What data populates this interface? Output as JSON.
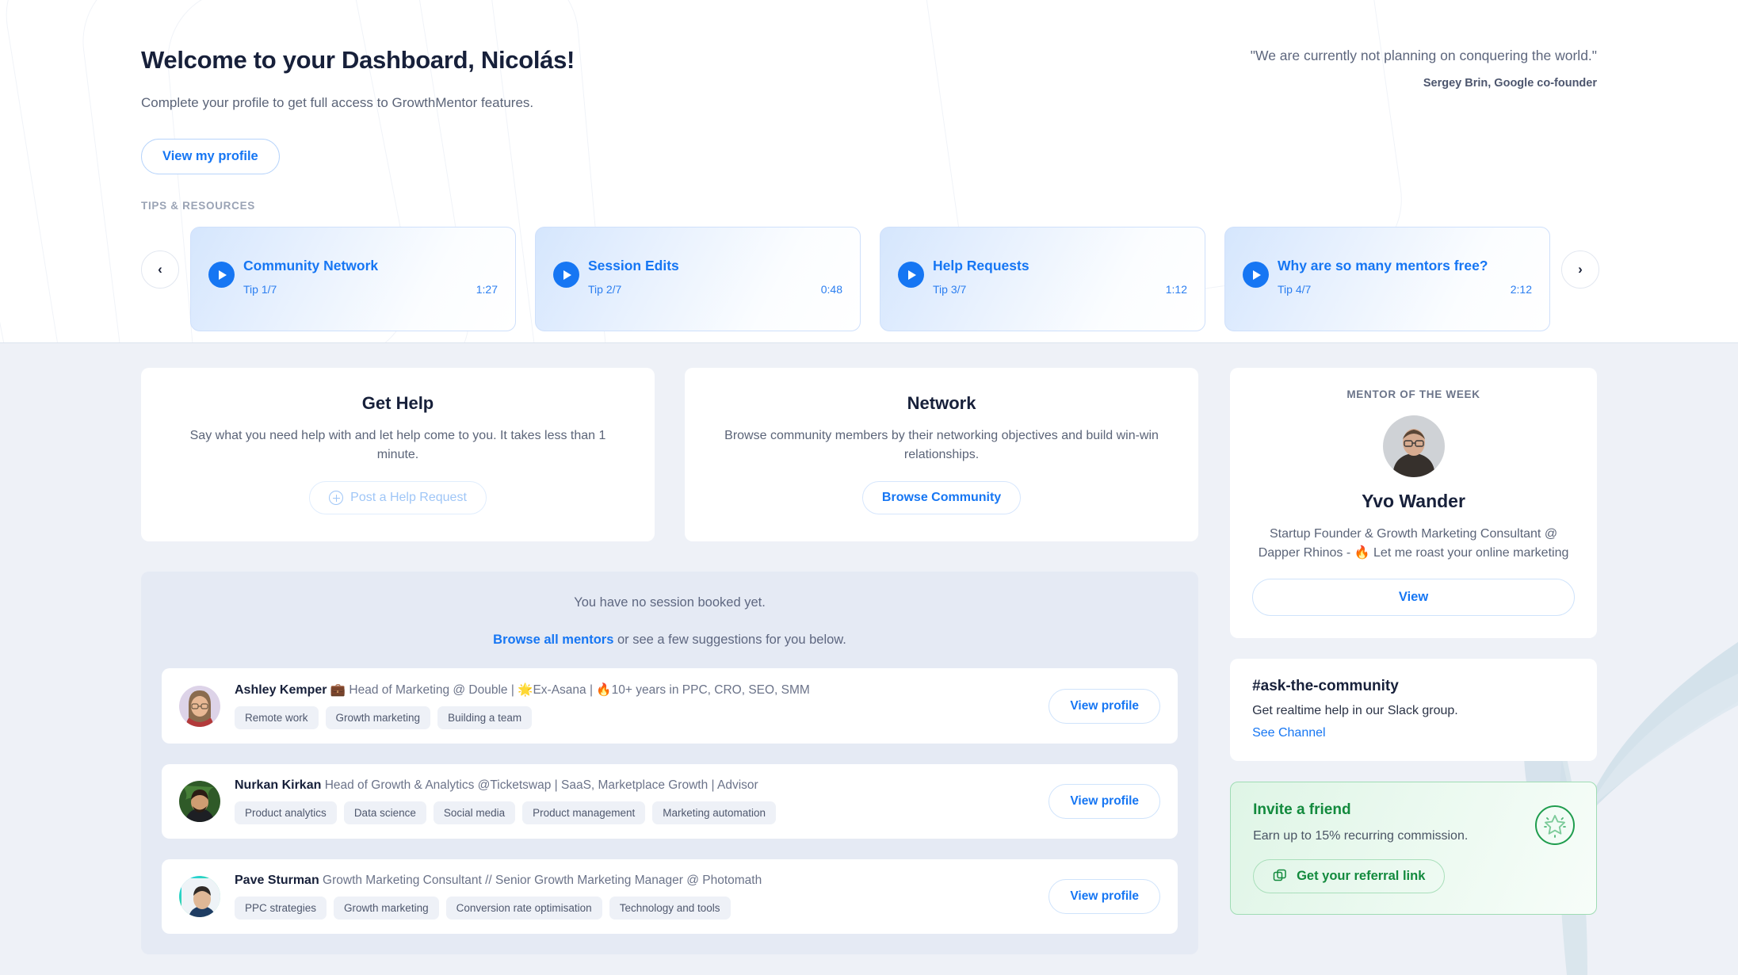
{
  "hero": {
    "title": "Welcome to your Dashboard, Nicolás!",
    "subtitle": "Complete your profile to get full access to GrowthMentor features.",
    "profile_button": "View my profile",
    "quote_text": "\"We are currently not planning on conquering the world.\"",
    "quote_author": "Sergey Brin, Google co-founder",
    "tips_label": "TIPS & RESOURCES",
    "prev_arrow": "‹",
    "next_arrow": "›"
  },
  "tips": [
    {
      "title": "Community Network",
      "index": "Tip 1/7",
      "duration": "1:27"
    },
    {
      "title": "Session Edits",
      "index": "Tip 2/7",
      "duration": "0:48"
    },
    {
      "title": "Help Requests",
      "index": "Tip 3/7",
      "duration": "1:12"
    },
    {
      "title": "Why are so many mentors free?",
      "index": "Tip 4/7",
      "duration": "2:12"
    }
  ],
  "get_help": {
    "title": "Get Help",
    "description": "Say what you need help with and let help come to you. It takes less than 1 minute.",
    "button": "Post a Help Request"
  },
  "network": {
    "title": "Network",
    "description": "Browse community members by their networking objectives and build win-win relationships.",
    "button": "Browse Community"
  },
  "sessions": {
    "empty_text": "You have no session booked yet.",
    "browse_link": "Browse all mentors",
    "browse_rest": " or see a few suggestions for you below."
  },
  "mentors": [
    {
      "name": "Ashley Kemper",
      "headline": "💼 Head of Marketing @ Double | 🌟Ex-Asana | 🔥10+ years in PPC, CRO, SEO, SMM",
      "tags": [
        "Remote work",
        "Growth marketing",
        "Building a team"
      ],
      "button": "View profile"
    },
    {
      "name": "Nurkan Kirkan",
      "headline": "Head of Growth & Analytics @Ticketswap | SaaS, Marketplace Growth | Advisor",
      "tags": [
        "Product analytics",
        "Data science",
        "Social media",
        "Product management",
        "Marketing automation"
      ],
      "button": "View profile"
    },
    {
      "name": "Pave Sturman",
      "headline": "Growth Marketing Consultant // Senior Growth Marketing Manager @ Photomath",
      "tags": [
        "PPC strategies",
        "Growth marketing",
        "Conversion rate optimisation",
        "Technology and tools"
      ],
      "button": "View profile"
    }
  ],
  "mentor_of_week": {
    "label": "MENTOR OF THE WEEK",
    "name": "Yvo Wander",
    "bio": "Startup Founder & Growth Marketing Consultant @ Dapper Rhinos - 🔥 Let me roast your online marketing",
    "button": "View"
  },
  "slack": {
    "title": "#ask-the-community",
    "description": "Get realtime help in our Slack group.",
    "link": "See Channel"
  },
  "invite": {
    "title": "Invite a friend",
    "description": "Earn up to 15% recurring commission.",
    "button": "Get your referral link"
  },
  "colors": {
    "accent_blue": "#1676f3",
    "green": "#128a3d",
    "page_bg": "#eef1f7",
    "panel_bg": "#e5eaf4"
  }
}
